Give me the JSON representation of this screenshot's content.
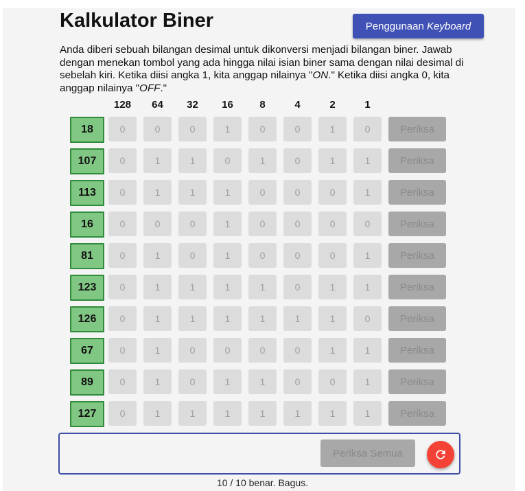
{
  "title": "Kalkulator Biner",
  "keyboard_button": {
    "prefix": "Penggunaan ",
    "italic": "Keyboard"
  },
  "description": {
    "part1": "Anda diberi sebuah bilangan desimal untuk dikonversi menjadi bilangan biner. Jawab dengan menekan tombol yang ada hingga nilai isian biner sama dengan nilai desimal di sebelah kiri. Ketika diisi angka 1, kita anggap nilainya \"",
    "on": "ON",
    "part2": ".\" Ketika diisi angka 0, kita anggap nilainya \"",
    "off": "OFF",
    "part3": ".\""
  },
  "place_values": [
    "128",
    "64",
    "32",
    "16",
    "8",
    "4",
    "2",
    "1"
  ],
  "rows": [
    {
      "decimal": "18",
      "bits": [
        "0",
        "0",
        "0",
        "1",
        "0",
        "0",
        "1",
        "0"
      ]
    },
    {
      "decimal": "107",
      "bits": [
        "0",
        "1",
        "1",
        "0",
        "1",
        "0",
        "1",
        "1"
      ]
    },
    {
      "decimal": "113",
      "bits": [
        "0",
        "1",
        "1",
        "1",
        "0",
        "0",
        "0",
        "1"
      ]
    },
    {
      "decimal": "16",
      "bits": [
        "0",
        "0",
        "0",
        "1",
        "0",
        "0",
        "0",
        "0"
      ]
    },
    {
      "decimal": "81",
      "bits": [
        "0",
        "1",
        "0",
        "1",
        "0",
        "0",
        "0",
        "1"
      ]
    },
    {
      "decimal": "123",
      "bits": [
        "0",
        "1",
        "1",
        "1",
        "1",
        "0",
        "1",
        "1"
      ]
    },
    {
      "decimal": "126",
      "bits": [
        "0",
        "1",
        "1",
        "1",
        "1",
        "1",
        "1",
        "0"
      ]
    },
    {
      "decimal": "67",
      "bits": [
        "0",
        "1",
        "0",
        "0",
        "0",
        "0",
        "1",
        "1"
      ]
    },
    {
      "decimal": "89",
      "bits": [
        "0",
        "1",
        "0",
        "1",
        "1",
        "0",
        "0",
        "1"
      ]
    },
    {
      "decimal": "127",
      "bits": [
        "0",
        "1",
        "1",
        "1",
        "1",
        "1",
        "1",
        "1"
      ]
    }
  ],
  "check_label": "Periksa",
  "check_all_label": "Periksa Semua",
  "reset_icon": "refresh-icon",
  "status": "10 / 10 benar. Bagus.",
  "colors": {
    "accent": "#3f51b5",
    "decimal_bg": "#81c784",
    "decimal_border": "#2e8b3a",
    "reset": "#f44336"
  }
}
